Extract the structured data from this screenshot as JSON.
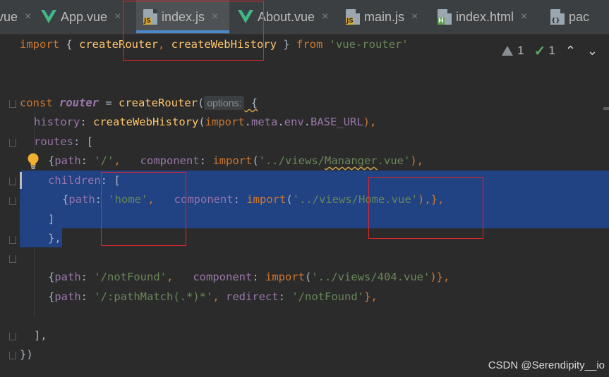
{
  "tabs": [
    {
      "label": "vue",
      "icon": "vue-icon",
      "active": false
    },
    {
      "label": "App.vue",
      "icon": "vue-icon",
      "active": false
    },
    {
      "label": "index.js",
      "icon": "js-file-icon",
      "active": true
    },
    {
      "label": "About.vue",
      "icon": "vue-icon",
      "active": false
    },
    {
      "label": "main.js",
      "icon": "js-file-icon",
      "active": false
    },
    {
      "label": "index.html",
      "icon": "html-file-icon",
      "active": false
    },
    {
      "label": "pac",
      "icon": "json-file-icon",
      "active": false
    }
  ],
  "icons": {
    "close": "×",
    "vue_color": "#42b883",
    "js_tag": "JS",
    "html_tag": "H",
    "json_tag": "{}"
  },
  "inspection": {
    "warnings": "1",
    "ok": "1",
    "up": "⌃",
    "down": "⌄"
  },
  "code": {
    "l1": {
      "kw_import": "import",
      "brace_open": " { ",
      "fn1": "createRouter",
      "comma": ", ",
      "fn2": "createWebHistory",
      "brace_close": " } ",
      "kw_from": "from",
      "space": " ",
      "str": "'vue-router'"
    },
    "l4": {
      "kw_const": "const",
      "sp": " ",
      "var": "router",
      "eq": " = ",
      "fn": "createRouter",
      "paren": "(",
      "hint": "options:",
      "brace": " {"
    },
    "l5": {
      "prop": "history",
      "colon": ": ",
      "fn": "createWebHistory",
      "paren": "(",
      "kw": "import",
      "dot1": ".",
      "meta": "meta",
      "dot2": ".",
      "env": "env",
      "dot3": ".",
      "base": "BASE_URL",
      "close": "),"
    },
    "l6": {
      "prop": "routes",
      "rest": ": ["
    },
    "l7": {
      "open": "{",
      "path_key": "path",
      "colon": ": ",
      "path_val": "'/'",
      "mid": ",   ",
      "comp_key": "component",
      "colon2": ": ",
      "kw": "import",
      "paren": "(",
      "str_a": "'../views/",
      "str_b": "Mananger",
      "str_c": ".vue'",
      "close": "),"
    },
    "l8": {
      "prop": "children",
      "rest": ": ["
    },
    "l9": {
      "open": "{",
      "path_key": "path",
      "colon": ": ",
      "path_val": "'home'",
      "mid": ",   ",
      "comp_key": "component",
      "colon2": ": ",
      "kw": "import",
      "paren": "(",
      "str": "'../views/Home.vue'",
      "close": "),},"
    },
    "l10": {
      "text": "]"
    },
    "l11": {
      "text": "},"
    },
    "l13": {
      "open": "{",
      "path_key": "path",
      "colon": ": ",
      "path_val": "'/notFound'",
      "mid": ",   ",
      "comp_key": "component",
      "colon2": ": ",
      "kw": "import",
      "paren": "(",
      "str": "'../views/404.vue'",
      "close": ")},"
    },
    "l14": {
      "open": "{",
      "path_key": "path",
      "colon": ": ",
      "path_val": "'/:pathMatch(.*)*'",
      "mid": ", ",
      "redir_key": "redirect",
      "colon2": ": ",
      "redir_val": "'/notFound'",
      "close": "},"
    },
    "l16": {
      "text": "],"
    },
    "l17": {
      "text": "})"
    }
  },
  "watermark": "CSDN @Serendipity__io"
}
